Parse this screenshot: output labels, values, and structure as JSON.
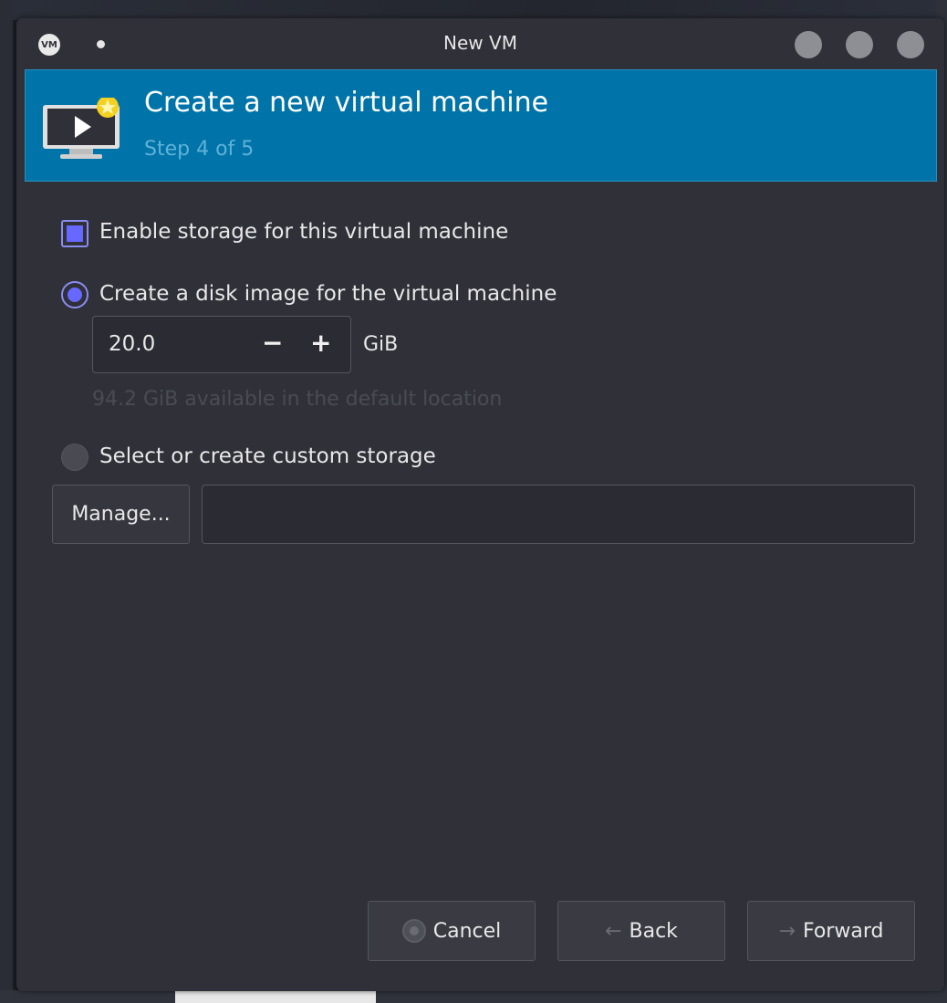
{
  "window": {
    "title": "New VM",
    "app_icon_text": "VM"
  },
  "header": {
    "title": "Create a new virtual machine",
    "step": "Step 4 of 5"
  },
  "storage": {
    "enable_label": "Enable storage for this virtual machine",
    "enable_checked": true,
    "create_disk_label": "Create a disk image for the virtual machine",
    "create_disk_selected": true,
    "disk_size": "20.0",
    "minus": "−",
    "plus": "+",
    "unit": "GiB",
    "available_text": "94.2 GiB available in the default location",
    "custom_label": "Select or create custom storage",
    "custom_selected": false,
    "manage_label": "Manage...",
    "path_value": ""
  },
  "buttons": {
    "cancel": "Cancel",
    "back": "Back",
    "forward": "Forward",
    "back_arrow": "←",
    "forward_arrow": "→"
  },
  "colors": {
    "header_bg": "#0073a8",
    "accent": "#6668ff",
    "window_bg": "#2f3038"
  }
}
